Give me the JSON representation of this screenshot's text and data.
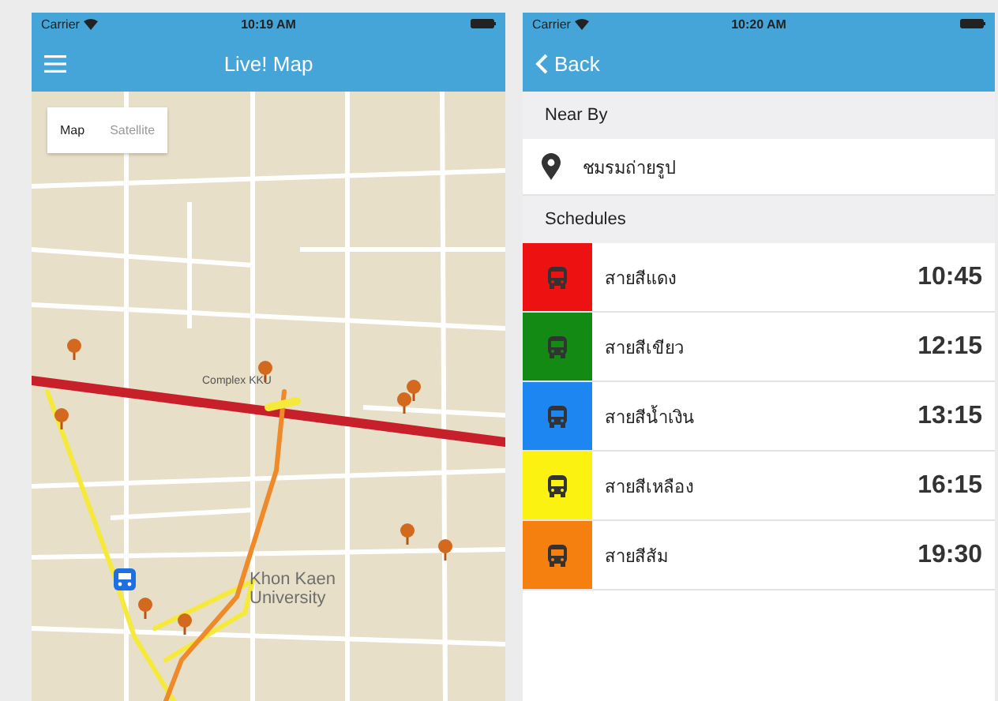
{
  "screens": [
    {
      "kind": "map",
      "status_bar": {
        "carrier": "Carrier",
        "time": "10:19 AM"
      },
      "nav": {
        "title": "Live! Map"
      },
      "map_type": [
        {
          "label": "Map",
          "selected": true
        },
        {
          "label": "Satellite",
          "selected": false
        }
      ],
      "map_labels": [
        {
          "kind": "small",
          "text": "Complex KKU"
        },
        {
          "kind": "big",
          "text": "Khon Kaen University"
        }
      ]
    },
    {
      "kind": "list",
      "status_bar": {
        "carrier": "Carrier",
        "time": "10:20 AM"
      },
      "nav": {
        "back": "Back"
      },
      "near_by": {
        "header": "Near By",
        "place": "ชมรมถ่ายรูป"
      },
      "schedules": {
        "header": "Schedules",
        "rows": [
          {
            "name": "สายสีแดง",
            "time": "10:45",
            "color": "#ee1111"
          },
          {
            "name": "สายสีเขียว",
            "time": "12:15",
            "color": "#138a13"
          },
          {
            "name": "สายสีน้ำเงิน",
            "time": "13:15",
            "color": "#1e86f0"
          },
          {
            "name": "สายสีเหลือง",
            "time": "16:15",
            "color": "#fbf212"
          },
          {
            "name": "สายสีส้ม",
            "time": "19:30",
            "color": "#f57f0f"
          }
        ]
      }
    }
  ]
}
